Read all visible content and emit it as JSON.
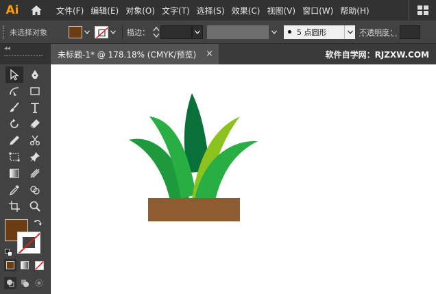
{
  "app": {
    "logo": "Ai"
  },
  "menu": [
    "文件(F)",
    "编辑(E)",
    "对象(O)",
    "文字(T)",
    "选择(S)",
    "效果(C)",
    "视图(V)",
    "窗口(W)",
    "帮助(H)"
  ],
  "control": {
    "selection_status": "未选择对象",
    "stroke_label": "描边：",
    "brush": "5 点圆形",
    "opacity_label": "不透明度："
  },
  "document": {
    "tab_title": "未标题-1* @ 178.18% (CMYK/预览)",
    "close_glyph": "×",
    "watermark": "软件自学网：RJZXW.COM"
  },
  "colors": {
    "fill": "#6b3d10",
    "leaf_dark": "#087038",
    "leaf_mid": "#1e9a3c",
    "leaf_light": "#28ae42",
    "leaf_lime": "#8cc21e",
    "pot": "#8e5c31"
  }
}
